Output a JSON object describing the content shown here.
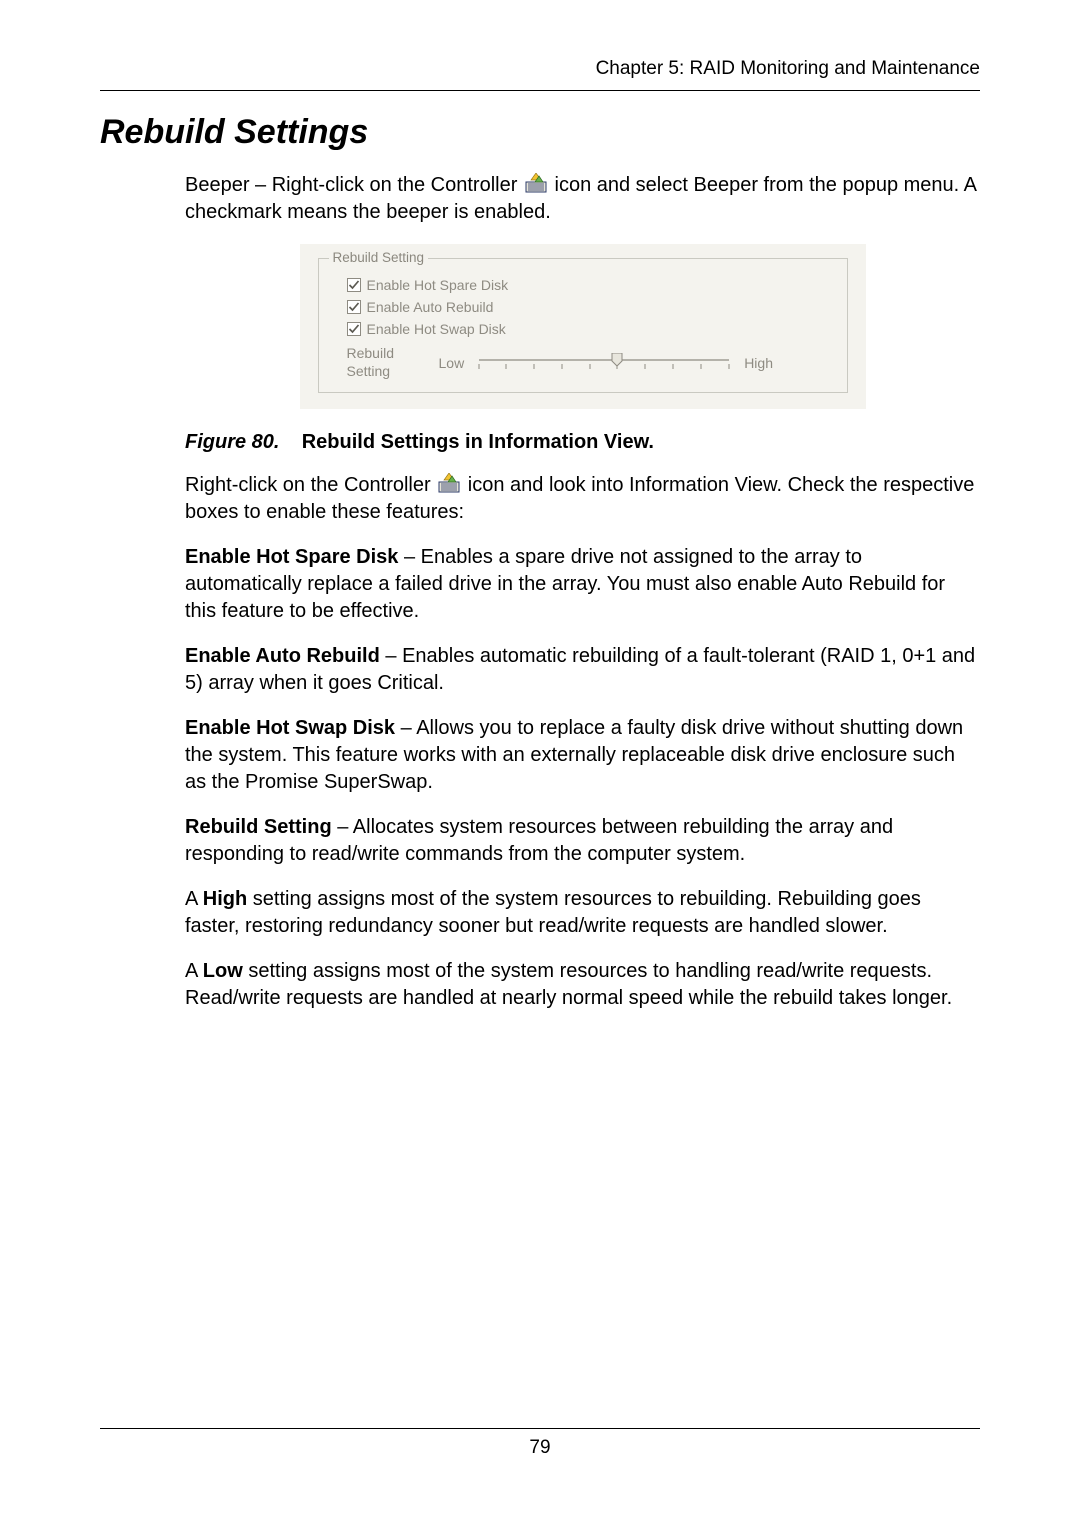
{
  "header": {
    "chapter": "Chapter 5: RAID Monitoring and Maintenance"
  },
  "section": {
    "title": "Rebuild Settings"
  },
  "intro": {
    "prefix": "Beeper – Right-click on the Controller ",
    "suffix": " icon and select Beeper from the popup menu. A checkmark means the beeper is enabled."
  },
  "panel": {
    "legend": "Rebuild Setting",
    "chk1": "Enable Hot Spare Disk",
    "chk2": "Enable Auto Rebuild",
    "chk3": "Enable Hot Swap Disk",
    "rebuild_label_line1": "Rebuild",
    "rebuild_label_line2": "Setting",
    "low": "Low",
    "high": "High"
  },
  "figure": {
    "number": "Figure 80.",
    "title": "Rebuild Settings in Information View."
  },
  "p2": {
    "prefix": "Right-click on the Controller ",
    "suffix": " icon and look into Information View. Check the respective boxes to enable these features:"
  },
  "p3": {
    "lead": "Enable Hot Spare Disk",
    "body": " – Enables a spare drive not assigned to the array to automatically replace a failed drive in the array. You must also enable Auto Rebuild for this feature to be effective."
  },
  "p4": {
    "lead": "Enable Auto Rebuild",
    "body": " – Enables automatic rebuilding of a fault-tolerant (RAID 1, 0+1 and 5) array when it goes Critical."
  },
  "p5": {
    "lead": "Enable Hot Swap Disk",
    "body": " – Allows you to replace a faulty disk drive without shutting down the system. This feature works with an externally replaceable disk drive enclosure such as the Promise SuperSwap."
  },
  "p6": {
    "lead": "Rebuild Setting",
    "body": " – Allocates system resources between rebuilding the array and responding to read/write commands from the computer system."
  },
  "p7": {
    "prefix": "A ",
    "lead": "High",
    "body": " setting assigns most of the system resources to rebuilding. Rebuilding goes faster, restoring redundancy sooner but read/write requests are handled slower."
  },
  "p8": {
    "prefix": "A ",
    "lead": "Low",
    "body": " setting assigns most of the system resources to handling read/write requests. Read/write requests are handled at nearly normal speed while the rebuild takes longer."
  },
  "footer": {
    "page_number": "79"
  },
  "icons": {
    "controller": "controller-icon"
  }
}
